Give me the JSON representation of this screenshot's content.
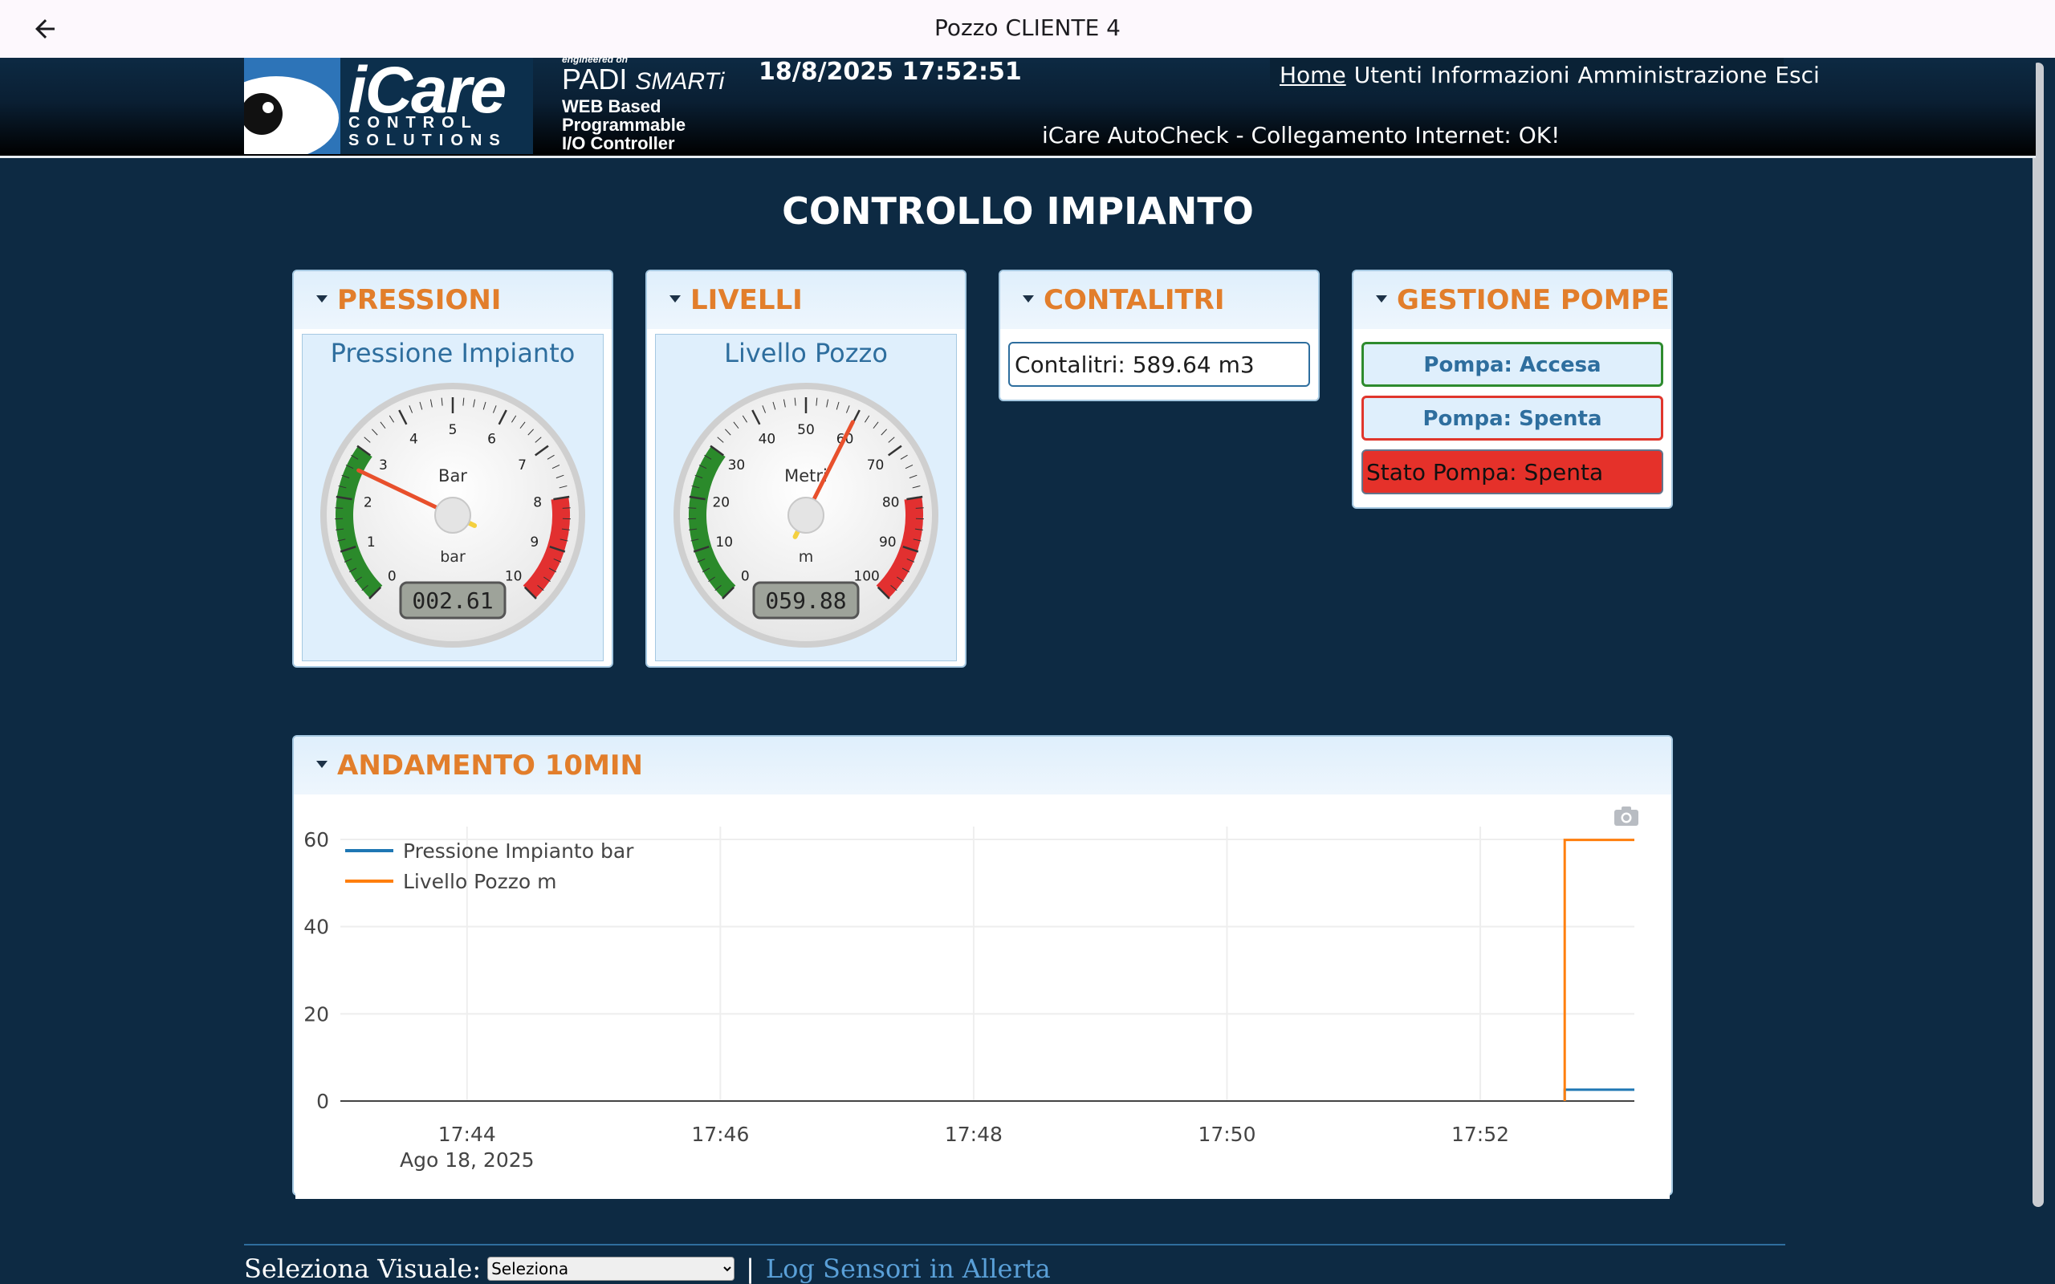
{
  "appbar": {
    "title": "Pozzo CLIENTE 4"
  },
  "header": {
    "logo_main": "iCare",
    "logo_sub1": "CONTROL",
    "logo_sub2": "SOLUTIONS",
    "padi_engineered": "engineered on",
    "padi_name": "PADI",
    "padi_smart": "SMARTi",
    "padi_desc1": "WEB Based",
    "padi_desc2": "Programmable",
    "padi_desc3": "I/O Controller",
    "datetime": "18/8/2025 17:52:51",
    "nav": [
      "Home",
      "Utenti",
      "Informazioni",
      "Amministrazione",
      "Esci"
    ],
    "autocheck": "iCare AutoCheck - Collegamento Internet: OK!"
  },
  "page_title": "CONTROLLO IMPIANTO",
  "panels": {
    "pressioni": {
      "title": "PRESSIONI",
      "gauge": {
        "label": "Pressione Impianto",
        "unit_top": "Bar",
        "unit_bottom": "bar",
        "display": "002.61",
        "value": 2.61,
        "min": 0,
        "max": 10,
        "ticks": [
          "0",
          "1",
          "2",
          "3",
          "4",
          "5",
          "6",
          "7",
          "8",
          "9",
          "10"
        ]
      }
    },
    "livelli": {
      "title": "LIVELLI",
      "gauge": {
        "label": "Livello Pozzo",
        "unit_top": "Metri",
        "unit_bottom": "m",
        "display": "059.88",
        "value": 59.88,
        "min": 0,
        "max": 100,
        "ticks": [
          "0",
          "10",
          "20",
          "30",
          "40",
          "50",
          "60",
          "70",
          "80",
          "90",
          "100"
        ]
      }
    },
    "contalitri": {
      "title": "CONTALITRI",
      "value": "Contalitri: 589.64 m3"
    },
    "gestione": {
      "title": "GESTIONE POMPE",
      "btn_on": "Pompa: Accesa",
      "btn_off": "Pompa: Spenta",
      "state": "Stato Pompa: Spenta"
    }
  },
  "trend": {
    "title": "ANDAMENTO 10MIN",
    "date_label": "Ago 18, 2025"
  },
  "chart_data": {
    "type": "line",
    "x_ticks": [
      "17:44",
      "17:46",
      "17:48",
      "17:50",
      "17:52"
    ],
    "xlim": [
      "17:43:00",
      "17:53:13"
    ],
    "ylim": [
      0,
      60
    ],
    "y_ticks": [
      0,
      20,
      40,
      60
    ],
    "grid": true,
    "legend": "top-left",
    "series": [
      {
        "name": "Pressione Impianto bar",
        "color": "#1f77b4",
        "x": [
          "17:52:40",
          "17:52:40",
          "17:53:13"
        ],
        "y": [
          0,
          2.61,
          2.61
        ]
      },
      {
        "name": "Livello Pozzo m",
        "color": "#ff7f0e",
        "x": [
          "17:52:40",
          "17:52:40",
          "17:53:13"
        ],
        "y": [
          0,
          59.88,
          59.88
        ]
      }
    ]
  },
  "footer": {
    "label": "Seleziona Visuale:",
    "select_value": "Seleziona",
    "separator": "|",
    "link": "Log Sensori in Allerta"
  }
}
